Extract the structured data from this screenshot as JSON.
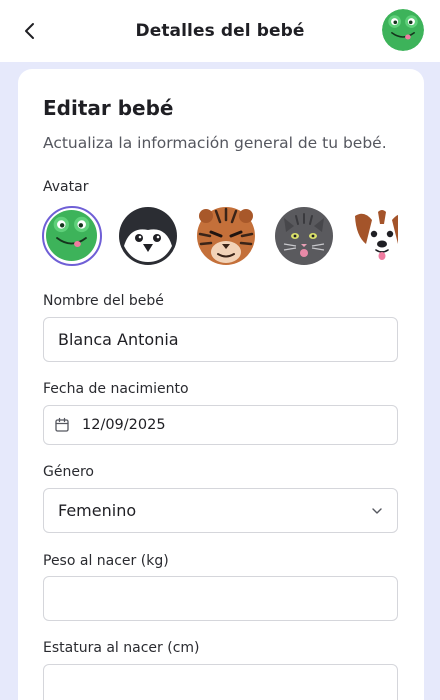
{
  "header": {
    "title": "Detalles del bebé",
    "back_icon": "chevron-left-icon",
    "avatar_icon": "frog-avatar-icon"
  },
  "form": {
    "title": "Editar bebé",
    "subtitle": "Actualiza la información general de tu bebé.",
    "avatar_label": "Avatar",
    "avatars": [
      {
        "name": "frog",
        "selected": true
      },
      {
        "name": "penguin",
        "selected": false
      },
      {
        "name": "tiger",
        "selected": false
      },
      {
        "name": "cat",
        "selected": false
      },
      {
        "name": "dog",
        "selected": false
      }
    ],
    "name_label": "Nombre del bebé",
    "name_value": "Blanca Antonia",
    "birth_label": "Fecha de nacimiento",
    "birth_value": "12/09/2025",
    "gender_label": "Género",
    "gender_value": "Femenino",
    "weight_label": "Peso al nacer (kg)",
    "weight_value": "",
    "height_label": "Estatura al nacer (cm)",
    "height_value": ""
  },
  "colors": {
    "background": "#e6e9fb",
    "accent": "#6f5fd6",
    "frog_green": "#3db35a"
  }
}
